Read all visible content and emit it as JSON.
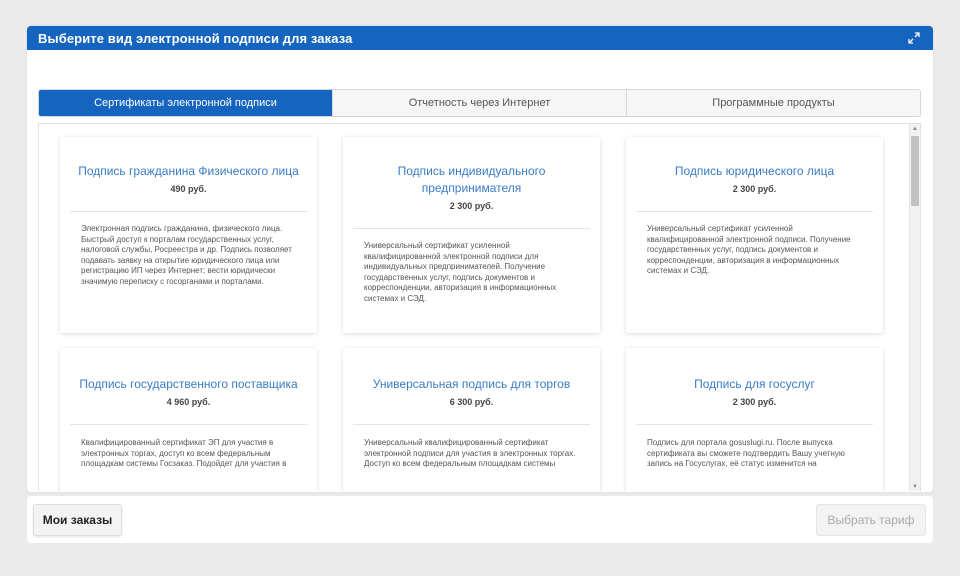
{
  "dialog": {
    "title": "Выберите вид электронной подписи для заказа",
    "expand_icon": "expand-icon",
    "accent_color": "#1565c0"
  },
  "tabs": [
    {
      "label": "Сертификаты электронной подписи",
      "active": true
    },
    {
      "label": "Отчетность через Интернет",
      "active": false
    },
    {
      "label": "Программные продукты",
      "active": false
    }
  ],
  "cards": [
    {
      "title": "Подпись гражданина Физического лица",
      "price": "490 руб.",
      "description": "Электронная подпись гражданина, физического лица. Быстрый доступ к порталам государственных услуг, налоговой службы, Росреестра и др. Подпись позволяет подавать заявку на открытие юридического лица или регистрацию ИП через Интернет; вести юридически значимую переписку с госорганами и порталами."
    },
    {
      "title": "Подпись индивидуального предпринимателя",
      "price": "2 300 руб.",
      "description": "Универсальный сертификат усиленной квалифицированной электронной подписи для индивидуальных предпринимателей. Получение государственных услуг, подпись документов и корреспонденции, авторизация в информационных системах и СЭД."
    },
    {
      "title": "Подпись юридического лица",
      "price": "2 300 руб.",
      "description": "Универсальный сертификат усиленной квалифицированной электронной подписи. Получение государственных услуг, подпись документов и корреспонденции, авторизация в информационных системах и СЭД."
    },
    {
      "title": "Подпись государственного поставщика",
      "price": "4 960 руб.",
      "description": "Квалифицированный сертификат ЭП для участия в электронных торгах, доступ ко всем федеральным площадкам системы Госзаказ. Подойдет для участия в"
    },
    {
      "title": "Универсальная подпись для торгов",
      "price": "6 300 руб.",
      "description": "Универсальный квалифицированный сертификат электронной подписи для участия в электронных торгах. Доступ ко всем федеральным площадкам системы"
    },
    {
      "title": "Подпись для госуслуг",
      "price": "2 300 руб.",
      "description": "Подпись для портала gosuslugi.ru. После выпуска сертификата вы сможете подтвердить Вашу учетную запись на Госуслугах, её статус изменится на"
    }
  ],
  "footer": {
    "orders_label": "Мои заказы",
    "select_label": "Выбрать тариф"
  },
  "scrollbar": {
    "up_icon": "scroll-up-arrow-icon",
    "down_icon": "scroll-down-arrow-icon"
  }
}
